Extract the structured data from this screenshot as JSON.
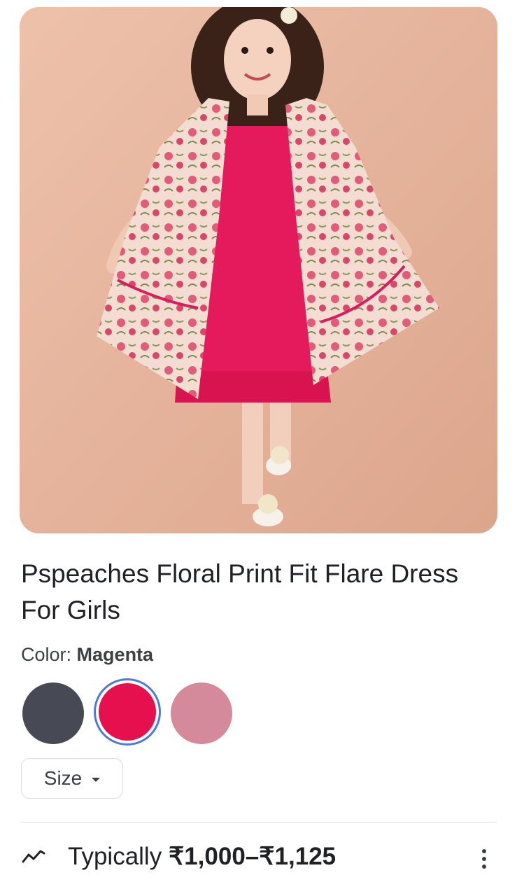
{
  "product": {
    "image_label": "Girl wearing floral print jacket over magenta fit and flare dress",
    "title": "Pspeaches Floral Print Fit Flare Dress For Girls"
  },
  "color": {
    "label": "Color:",
    "selected": "Magenta",
    "swatches": [
      {
        "hex": "#474a55"
      },
      {
        "hex": "#e6104e"
      },
      {
        "hex": "#d58a9c"
      }
    ]
  },
  "size": {
    "label": "Size"
  },
  "price": {
    "prefix": "Typically",
    "range": "₹1,000–₹1,125"
  },
  "icons": {
    "trend": "trend-icon",
    "more": "more-vert-icon",
    "dropdown": "caret-down-icon"
  }
}
